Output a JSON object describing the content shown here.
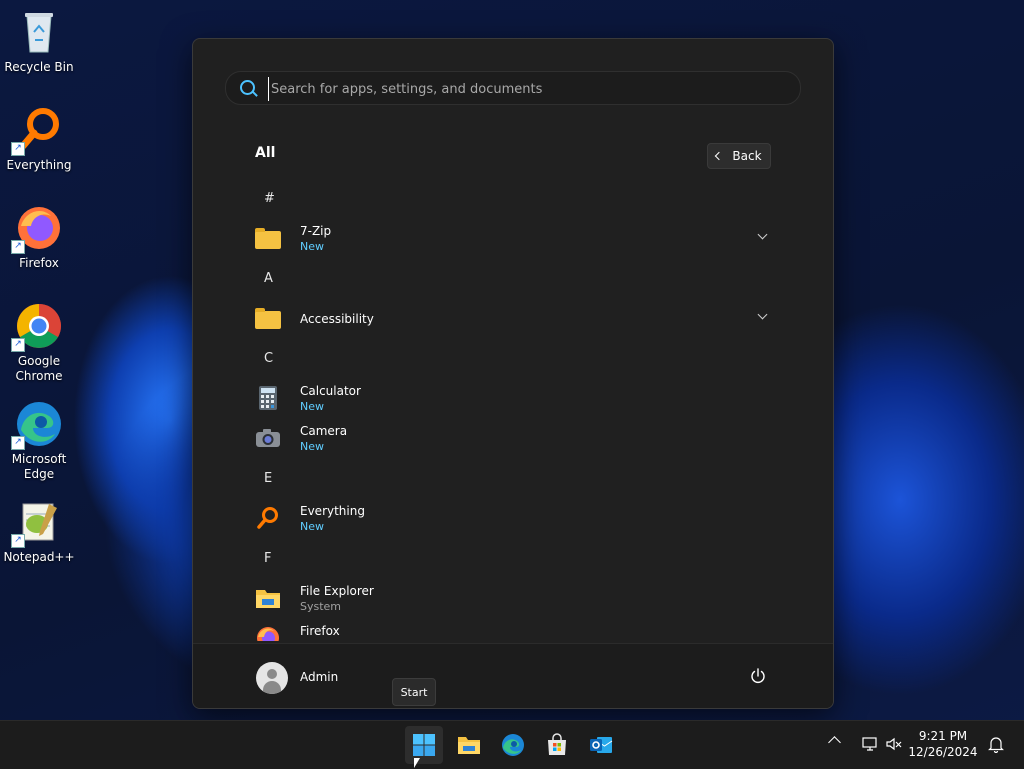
{
  "desktop": {
    "icons": [
      {
        "label_line1": "Recycle Bin",
        "label_line2": ""
      },
      {
        "label_line1": "Everything",
        "label_line2": ""
      },
      {
        "label_line1": "Firefox",
        "label_line2": ""
      },
      {
        "label_line1": "Google",
        "label_line2": "Chrome"
      },
      {
        "label_line1": "Microsoft",
        "label_line2": "Edge"
      },
      {
        "label_line1": "Notepad++",
        "label_line2": ""
      }
    ]
  },
  "start_menu": {
    "search_placeholder": "Search for apps, settings, and documents",
    "heading": "All",
    "back_label": "Back",
    "letters": [
      "#",
      "A",
      "C",
      "E",
      "F"
    ],
    "apps": [
      {
        "name": "7-Zip",
        "sub": "New",
        "icon": "folder-icon"
      },
      {
        "name": "Accessibility",
        "sub": "",
        "icon": "folder-icon"
      },
      {
        "name": "Calculator",
        "sub": "New",
        "icon": "calculator-icon"
      },
      {
        "name": "Camera",
        "sub": "New",
        "icon": "camera-icon"
      },
      {
        "name": "Everything",
        "sub": "New",
        "icon": "everything-icon"
      },
      {
        "name": "File Explorer",
        "sub": "System",
        "icon": "file-explorer-icon"
      },
      {
        "name": "Firefox",
        "sub": "",
        "icon": "firefox-icon"
      }
    ],
    "user_name": "Admin"
  },
  "tooltip": "Start",
  "taskbar": {
    "apps": [
      "windows-start-icon",
      "file-explorer-icon",
      "edge-icon",
      "store-icon",
      "outlook-icon"
    ],
    "clock_time": "9:21 PM",
    "clock_date": "12/26/2024"
  },
  "colors": {
    "accent": "#60cdff",
    "menu_bg": "#202020",
    "taskbar_bg": "#1c1c1c"
  }
}
